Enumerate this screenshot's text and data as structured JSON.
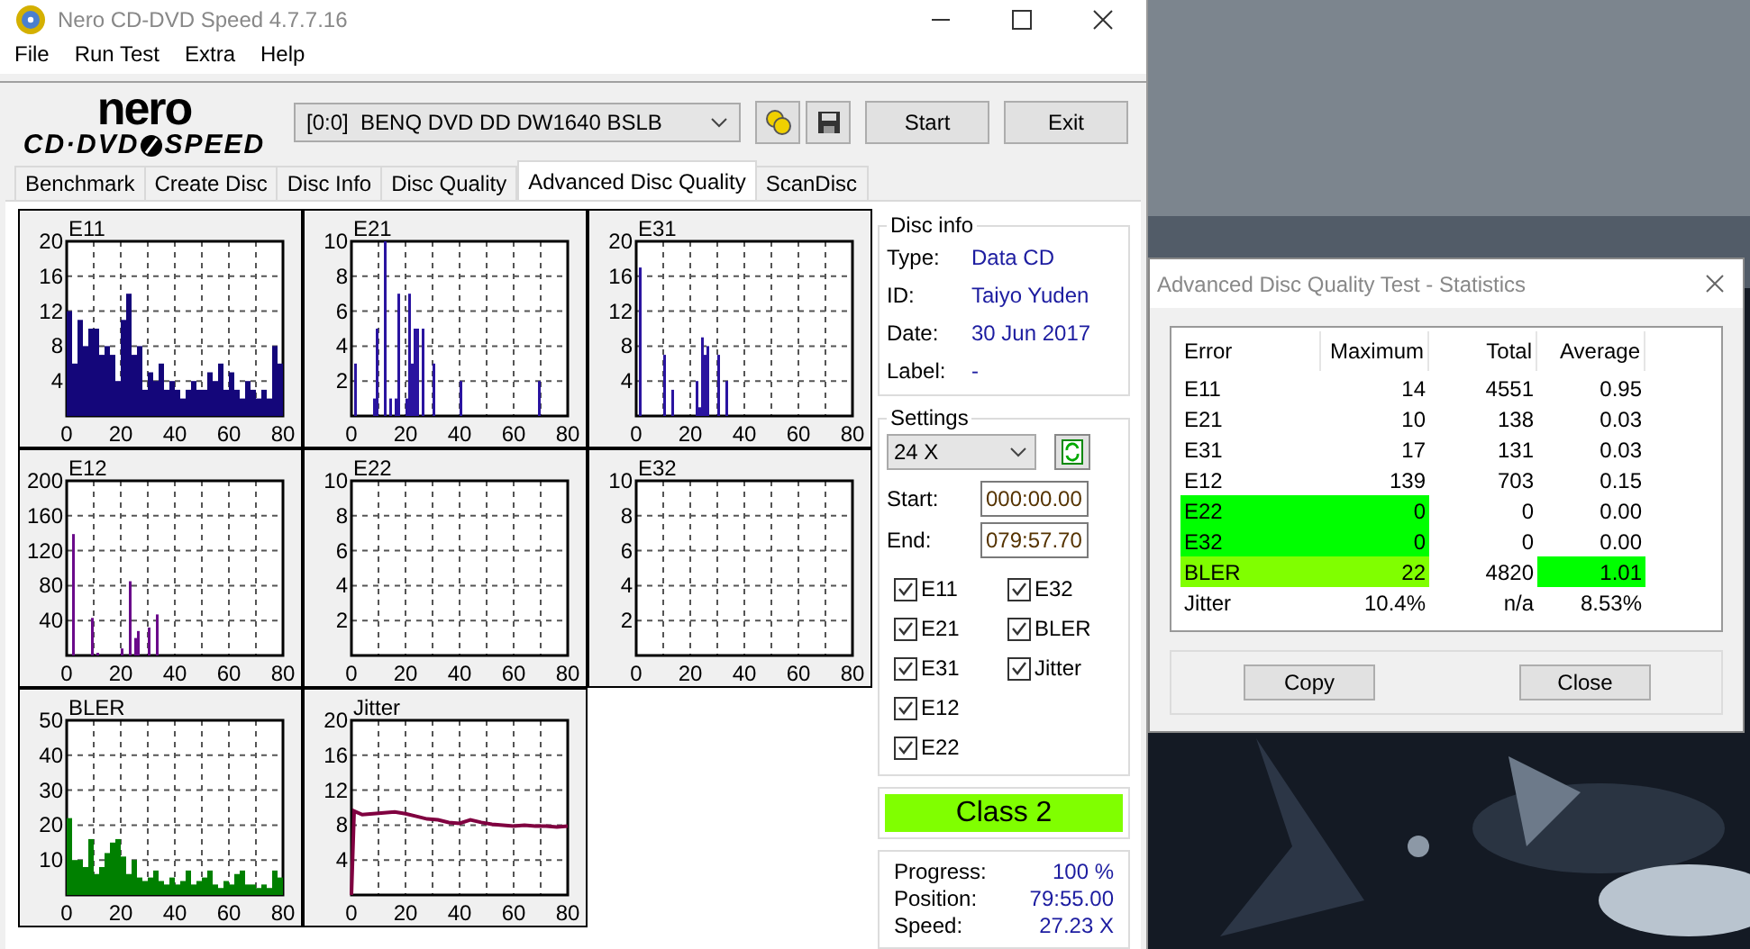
{
  "window": {
    "title": "Nero CD-DVD Speed 4.7.7.16"
  },
  "menu": [
    "File",
    "Run Test",
    "Extra",
    "Help"
  ],
  "logo": {
    "line1": "nero",
    "line2a": "CD·DVD",
    "line2b": "SPEED"
  },
  "drive": {
    "value": "[0:0]  BENQ DVD DD DW1640 BSLB"
  },
  "buttons": [
    "Start",
    "Exit"
  ],
  "tabs": [
    {
      "label": "Benchmark",
      "selected": false
    },
    {
      "label": "Create Disc",
      "selected": false
    },
    {
      "label": "Disc Info",
      "selected": false
    },
    {
      "label": "Disc Quality",
      "selected": false
    },
    {
      "label": "Advanced Disc Quality",
      "selected": true
    },
    {
      "label": "ScanDisc",
      "selected": false
    }
  ],
  "charts": [
    {
      "chart_data": {
        "type": "bar",
        "title": "E11",
        "xlim": [
          0,
          80
        ],
        "ylim": [
          0,
          20
        ],
        "xticks": [
          0,
          20,
          40,
          60,
          80
        ],
        "yticks": [
          4,
          8,
          12,
          16,
          20
        ],
        "x": [
          0,
          2,
          4,
          6,
          8,
          10,
          12,
          14,
          16,
          18,
          20,
          22,
          24,
          26,
          28,
          30,
          32,
          34,
          36,
          38,
          40,
          42,
          44,
          46,
          48,
          50,
          52,
          54,
          56,
          58,
          60,
          62,
          64,
          66,
          68,
          70,
          72,
          74,
          76,
          78
        ],
        "grid": true,
        "series": [
          {
            "color": "#14067a",
            "values": [
              12,
              6,
              11,
              8,
              10,
              10,
              7,
              8,
              7,
              4,
              11,
              14,
              7,
              8,
              3,
              5,
              4,
              6,
              3,
              4,
              3,
              2,
              3,
              4,
              3,
              3,
              5,
              4,
              6,
              3,
              5,
              3,
              2,
              4,
              3,
              2,
              3,
              2,
              8,
              6
            ]
          }
        ]
      }
    },
    {
      "chart_data": {
        "type": "bar",
        "title": "E21",
        "xlim": [
          0,
          80
        ],
        "ylim": [
          0,
          10
        ],
        "xticks": [
          0,
          20,
          40,
          60,
          80
        ],
        "yticks": [
          2,
          4,
          6,
          8,
          10
        ],
        "x": [
          1,
          8,
          9,
          12,
          14,
          16,
          17,
          20,
          21,
          22,
          23,
          24,
          26,
          30,
          40,
          69
        ],
        "grid": true,
        "series": [
          {
            "color": "#2a14a0",
            "values": [
              3,
              1,
              5,
              10,
              1,
              1,
              7,
              1,
              7,
              3,
              5,
              5,
              5,
              3,
              2,
              2
            ]
          }
        ]
      }
    },
    {
      "chart_data": {
        "type": "bar",
        "title": "E31",
        "xlim": [
          0,
          80
        ],
        "ylim": [
          0,
          20
        ],
        "xticks": [
          0,
          20,
          40,
          60,
          80
        ],
        "yticks": [
          4,
          8,
          12,
          16,
          20
        ],
        "x": [
          1,
          10,
          13,
          22,
          23,
          24,
          25,
          26,
          30,
          33
        ],
        "grid": true,
        "series": [
          {
            "color": "#2a14a0",
            "values": [
              17,
              7,
              3,
              4,
              1,
              9,
              7,
              8,
              7,
              4
            ]
          }
        ]
      }
    },
    {
      "chart_data": {
        "type": "bar",
        "title": "E12",
        "xlim": [
          0,
          80
        ],
        "ylim": [
          0,
          200
        ],
        "xticks": [
          0,
          20,
          40,
          60,
          80
        ],
        "yticks": [
          40,
          80,
          120,
          160,
          200
        ],
        "x": [
          2,
          9,
          11,
          20,
          23,
          25,
          26,
          30,
          33
        ],
        "grid": true,
        "series": [
          {
            "color": "#6a0a8a",
            "values": [
              139,
              43,
              3,
              8,
              85,
              20,
              28,
              32,
              47
            ]
          }
        ]
      }
    },
    {
      "chart_data": {
        "type": "bar",
        "title": "E22",
        "xlim": [
          0,
          80
        ],
        "ylim": [
          0,
          10
        ],
        "xticks": [
          0,
          20,
          40,
          60,
          80
        ],
        "yticks": [
          2,
          4,
          6,
          8,
          10
        ],
        "grid": true
      }
    },
    {
      "chart_data": {
        "type": "bar",
        "title": "E32",
        "xlim": [
          0,
          80
        ],
        "ylim": [
          0,
          10
        ],
        "xticks": [
          0,
          20,
          40,
          60,
          80
        ],
        "yticks": [
          2,
          4,
          6,
          8,
          10
        ],
        "grid": true
      }
    },
    {
      "chart_data": {
        "type": "bar",
        "title": "BLER",
        "xlim": [
          0,
          80
        ],
        "ylim": [
          0,
          50
        ],
        "xticks": [
          0,
          20,
          40,
          60,
          80
        ],
        "yticks": [
          10,
          20,
          30,
          40,
          50
        ],
        "x": [
          0,
          2,
          4,
          6,
          8,
          10,
          12,
          14,
          16,
          18,
          20,
          22,
          24,
          26,
          28,
          30,
          32,
          34,
          36,
          38,
          40,
          42,
          44,
          46,
          48,
          50,
          52,
          54,
          56,
          58,
          60,
          62,
          64,
          66,
          68,
          70,
          72,
          74,
          76,
          78
        ],
        "grid": true,
        "series": [
          {
            "color": "#008000",
            "values": [
              22,
              10,
              10,
              8,
              16,
              6,
              8,
              12,
              15,
              16,
              11,
              6,
              10,
              5,
              4,
              5,
              7,
              4,
              3,
              5,
              3,
              4,
              7,
              3,
              4,
              5,
              7,
              3,
              2,
              4,
              3,
              6,
              7,
              3,
              3,
              2,
              3,
              2,
              7,
              5
            ]
          }
        ]
      }
    },
    {
      "chart_data": {
        "type": "line",
        "title": "Jitter",
        "xlim": [
          0,
          80
        ],
        "ylim": [
          0,
          20
        ],
        "xticks": [
          0,
          20,
          40,
          60,
          80
        ],
        "yticks": [
          4,
          8,
          12,
          16,
          20
        ],
        "x": [
          0,
          1,
          4,
          8,
          12,
          16,
          20,
          24,
          28,
          32,
          36,
          40,
          44,
          48,
          52,
          56,
          60,
          64,
          68,
          72,
          76,
          80
        ],
        "grid": true,
        "series": [
          {
            "color": "#800040",
            "values": [
              0,
              9.6,
              9.2,
              9.3,
              9.4,
              9.5,
              9.3,
              9.0,
              8.7,
              8.6,
              8.3,
              8.2,
              8.6,
              8.3,
              8.1,
              8.0,
              7.9,
              8.0,
              7.9,
              7.9,
              7.8,
              7.9
            ]
          }
        ]
      }
    }
  ],
  "disc_info": {
    "title": "Disc info",
    "fields": [
      {
        "label": "Type:",
        "value": "Data CD"
      },
      {
        "label": "ID:",
        "value": "Taiyo Yuden"
      },
      {
        "label": "Date:",
        "value": "30 Jun 2017"
      },
      {
        "label": "Label:",
        "value": "-"
      }
    ]
  },
  "settings": {
    "title": "Settings",
    "speed": "24 X",
    "start": {
      "label": "Start:",
      "value": "000:00.00"
    },
    "end": {
      "label": "End:",
      "value": "079:57.70"
    },
    "checks": [
      {
        "label": "E11",
        "checked": true
      },
      {
        "label": "E21",
        "checked": true
      },
      {
        "label": "E31",
        "checked": true
      },
      {
        "label": "E12",
        "checked": true
      },
      {
        "label": "E22",
        "checked": true
      },
      {
        "label": "E32",
        "checked": true
      },
      {
        "label": "BLER",
        "checked": true
      },
      {
        "label": "Jitter",
        "checked": true
      }
    ]
  },
  "class": {
    "text": "Class 2"
  },
  "progress": [
    {
      "label": "Progress:",
      "value": "100 %"
    },
    {
      "label": "Position:",
      "value": "79:55.00"
    },
    {
      "label": "Speed:",
      "value": "27.23 X"
    }
  ],
  "statistics": {
    "title": "Advanced Disc Quality Test - Statistics",
    "columns": [
      "Error",
      "Maximum",
      "Total",
      "Average"
    ],
    "rows": [
      {
        "cells": [
          {
            "text": "E11"
          },
          {
            "text": "14"
          },
          {
            "text": "4551"
          },
          {
            "text": "0.95"
          }
        ]
      },
      {
        "cells": [
          {
            "text": "E21"
          },
          {
            "text": "10"
          },
          {
            "text": "138"
          },
          {
            "text": "0.03"
          }
        ]
      },
      {
        "cells": [
          {
            "text": "E31"
          },
          {
            "text": "17"
          },
          {
            "text": "131"
          },
          {
            "text": "0.03"
          }
        ]
      },
      {
        "cells": [
          {
            "text": "E12"
          },
          {
            "text": "139"
          },
          {
            "text": "703"
          },
          {
            "text": "0.15"
          }
        ]
      },
      {
        "cells": [
          {
            "text": "E22",
            "color": "#00ff00"
          },
          {
            "text": "0",
            "color": "#00ff00"
          },
          {
            "text": "0"
          },
          {
            "text": "0.00"
          }
        ]
      },
      {
        "cells": [
          {
            "text": "E32",
            "color": "#00ff00"
          },
          {
            "text": "0",
            "color": "#00ff00"
          },
          {
            "text": "0"
          },
          {
            "text": "0.00"
          }
        ]
      },
      {
        "cells": [
          {
            "text": "BLER",
            "color": "#80ff00"
          },
          {
            "text": "22",
            "color": "#80ff00"
          },
          {
            "text": "4820"
          },
          {
            "text": "1.01",
            "color": "#00ff00"
          }
        ]
      },
      {
        "cells": [
          {
            "text": "Jitter"
          },
          {
            "text": "10.4%"
          },
          {
            "text": "n/a"
          },
          {
            "text": "8.53%"
          }
        ]
      }
    ],
    "buttons": [
      "Copy",
      "Close"
    ]
  }
}
